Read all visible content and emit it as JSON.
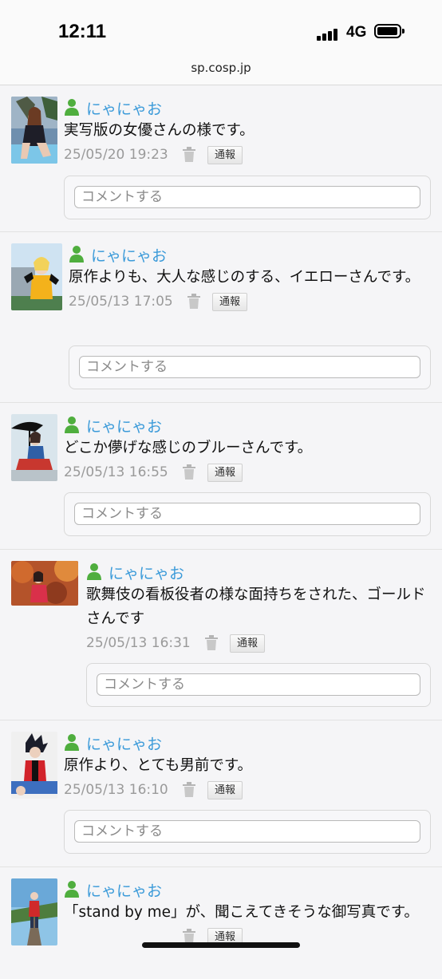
{
  "status": {
    "time": "12:11",
    "network": "4G"
  },
  "browser": {
    "url": "sp.cosp.jp"
  },
  "comments": [
    {
      "user": "にゃにゃお",
      "text": "実写版の女優さんの様です。",
      "date": "25/05/20 19:23",
      "report": "通報",
      "placeholder": "コメントする"
    },
    {
      "user": "にゃにゃお",
      "text": "原作よりも、大人な感じのする、イエローさんです。",
      "date": "25/05/13 17:05",
      "report": "通報",
      "placeholder": "コメントする"
    },
    {
      "user": "にゃにゃお",
      "text": "どこか儚げな感じのブルーさんです。",
      "date": "25/05/13 16:55",
      "report": "通報",
      "placeholder": "コメントする"
    },
    {
      "user": "にゃにゃお",
      "text": "歌舞伎の看板役者の様な面持ちをされた、ゴールドさんです",
      "date": "25/05/13 16:31",
      "report": "通報",
      "placeholder": "コメントする"
    },
    {
      "user": "にゃにゃお",
      "text": "原作より、とても男前です。",
      "date": "25/05/13 16:10",
      "report": "通報",
      "placeholder": "コメントする"
    },
    {
      "user": "にゃにゃお",
      "text": "「stand by me」が、聞こえてきそうな御写真です。",
      "date": "",
      "report": "通報",
      "placeholder": ""
    }
  ]
}
